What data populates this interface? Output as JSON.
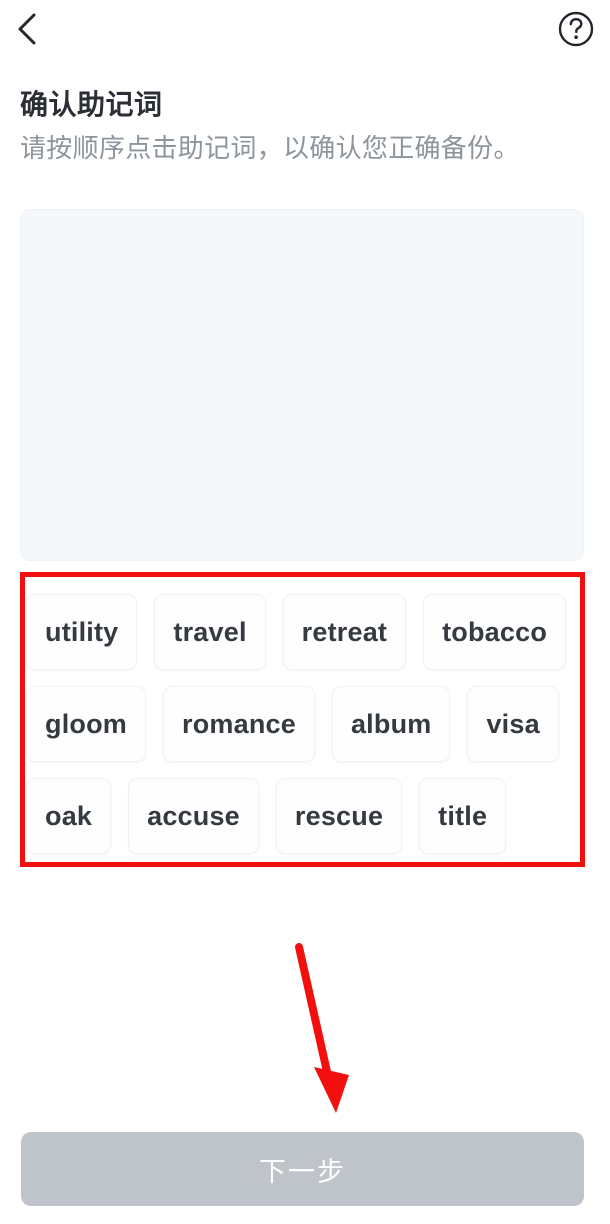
{
  "topbar": {
    "back_icon": "chevron-left-icon",
    "help_icon": "question-circle-icon"
  },
  "header": {
    "title": "确认助记词",
    "subtitle": "请按顺序点击助记词，以确认您正确备份。"
  },
  "selected_panel": {
    "selected_words": []
  },
  "word_bank": {
    "rows": [
      [
        "utility",
        "travel",
        "retreat",
        "tobacco"
      ],
      [
        "gloom",
        "romance",
        "album",
        "visa"
      ],
      [
        "oak",
        "accuse",
        "rescue",
        "title"
      ]
    ],
    "words": [
      "utility",
      "travel",
      "retreat",
      "tobacco",
      "gloom",
      "romance",
      "album",
      "visa",
      "oak",
      "accuse",
      "rescue",
      "title"
    ]
  },
  "footer": {
    "next_label": "下一步",
    "next_enabled": false
  },
  "annotations": {
    "highlight_color": "#f40f0f",
    "arrow_color": "#f40f0f",
    "arrow_target": "next-button"
  },
  "colors": {
    "title_text": "#2b2e34",
    "subtitle_text": "#8d949c",
    "panel_background": "#f5f8fb",
    "chip_background": "#fefefe",
    "chip_text": "#353a41",
    "button_disabled": "#bfc3ca",
    "button_text": "#ffffff"
  }
}
